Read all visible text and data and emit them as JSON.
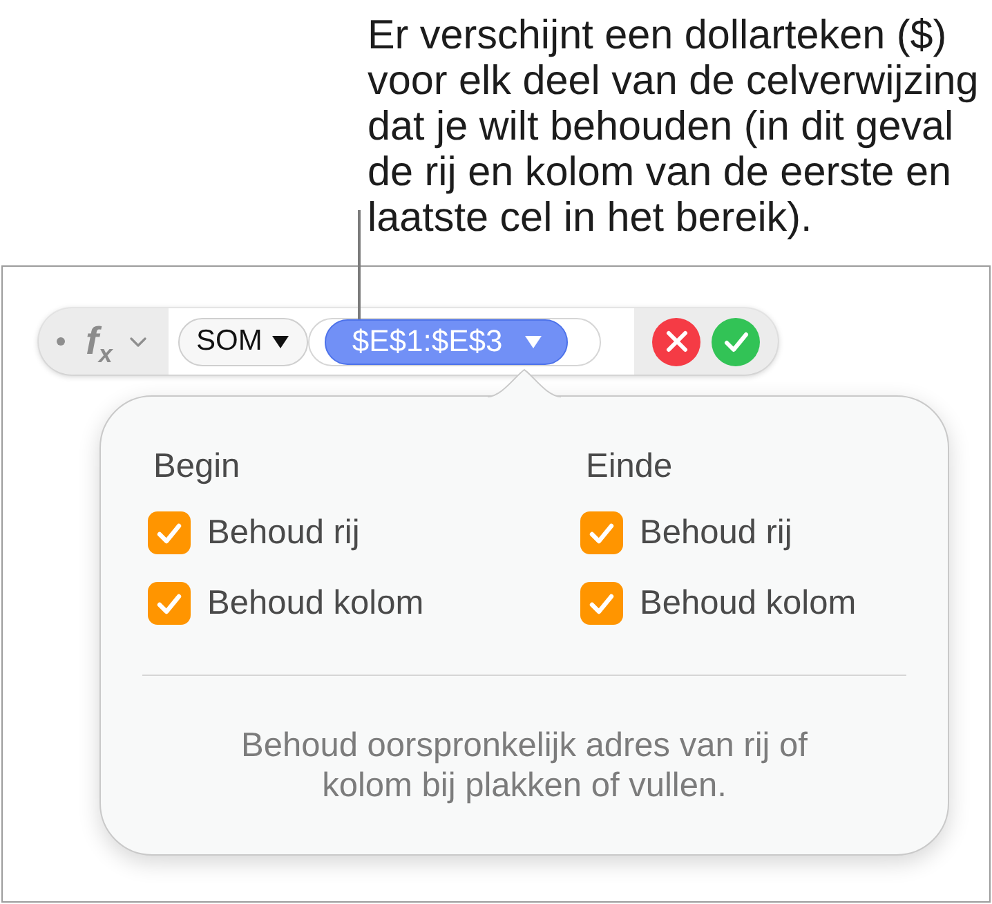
{
  "callout": {
    "text": "Er verschijnt een dollarteken ($)\nvoor elk deel van de celverwijzing\ndat je wilt behouden (in dit geval\nde rij en kolom van de eerste en\nlaatste cel in het bereik)."
  },
  "formula_bar": {
    "function_symbol": "f$_{x}$",
    "function_name": "SOM",
    "range_token": {
      "text": "$E$1:$E$3",
      "selected": true
    }
  },
  "popover": {
    "groups": [
      {
        "heading": "Begin",
        "options": [
          {
            "label": "Behoud rij",
            "checked": true
          },
          {
            "label": "Behoud kolom",
            "checked": true
          }
        ]
      },
      {
        "heading": "Einde",
        "options": [
          {
            "label": "Behoud rij",
            "checked": true
          },
          {
            "label": "Behoud kolom",
            "checked": true
          }
        ]
      }
    ],
    "note": "Behoud oorspronkelijk adres van rij of\nkolom bij plakken of vullen."
  }
}
